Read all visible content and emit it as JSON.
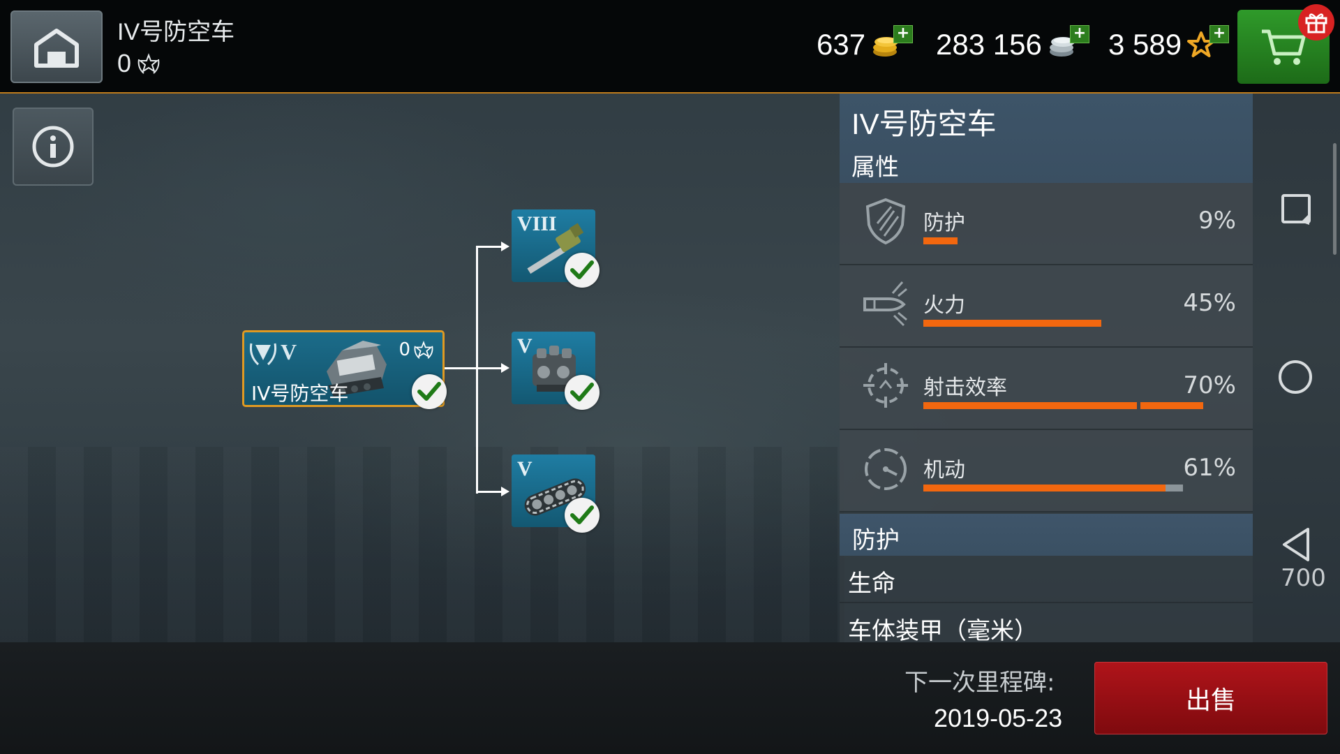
{
  "header": {
    "tank_name": "IV号防空车",
    "mastery_count": "0"
  },
  "currency": {
    "gold": "637",
    "silver": "283 156",
    "free_xp": "3 589",
    "plus": "+"
  },
  "tree": {
    "tank_tier": "V",
    "tank_name": "IV号防空车",
    "tank_mastery": "0",
    "modules": [
      {
        "tier": "VIII",
        "type": "gun-icon",
        "researched": true
      },
      {
        "tier": "V",
        "type": "engine-icon",
        "researched": true
      },
      {
        "tier": "V",
        "type": "tracks-icon",
        "researched": true
      }
    ]
  },
  "panel": {
    "title": "IV号防空车",
    "subtitle": "属性",
    "stats": [
      {
        "label": "防护",
        "value": "9%",
        "fill": 0.09
      },
      {
        "label": "火力",
        "value": "45%",
        "fill": 0.45
      },
      {
        "label": "射击效率",
        "value": "70%",
        "fill": 0.7
      },
      {
        "label": "机动",
        "value": "61%",
        "fill": 0.61
      }
    ],
    "section_title": "防护",
    "rows": [
      {
        "label": "生命",
        "value": "700"
      },
      {
        "label": "车体装甲（毫米）",
        "value": ""
      }
    ]
  },
  "footer": {
    "milestone_label": "下一次里程碑:",
    "milestone_date": "2019-05-23",
    "sell_label": "出售"
  },
  "colors": {
    "accent_orange": "#f2670f",
    "sell_red": "#a01218",
    "shop_green": "#2a8a25"
  }
}
